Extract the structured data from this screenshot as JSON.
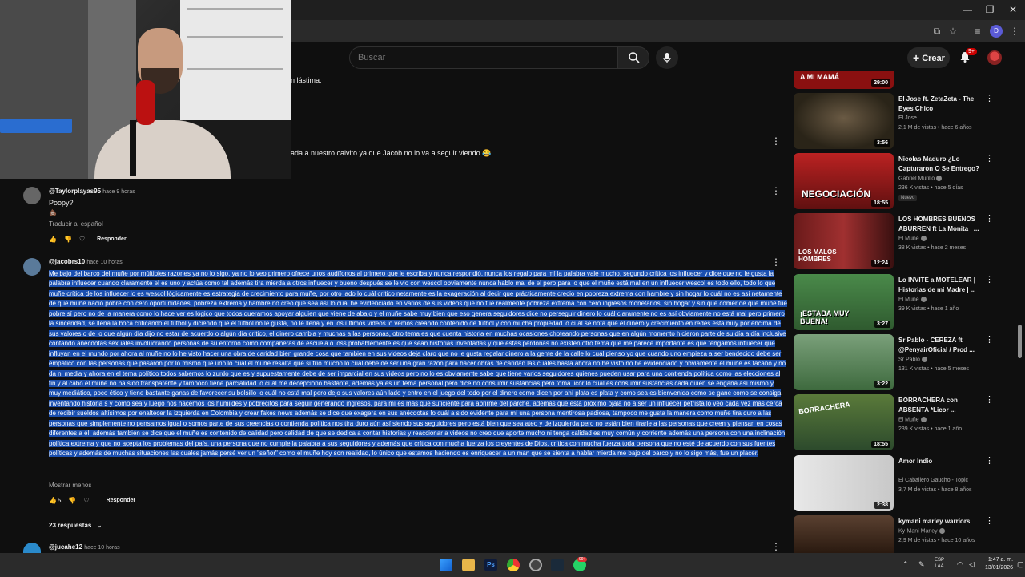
{
  "browser": {
    "window_controls": {
      "minimize": "—",
      "maximize": "❐",
      "close": "✕"
    },
    "profile_initial": "D"
  },
  "header": {
    "search_placeholder": "Buscar",
    "create_label": "Crear",
    "notifications_badge": "9+"
  },
  "partial_texts": {
    "line1": "n lástima.",
    "line2": "ada a nuestro calvito ya que Jacob no lo va a seguir viendo 😂"
  },
  "comments": [
    {
      "handle": "@Taylorplayas95",
      "time": "hace 9 horas",
      "text": "Poopy?",
      "emoji": "💩",
      "translate": "Traducir al español",
      "reply": "Responder"
    },
    {
      "handle": "@jacobrs10",
      "time": "hace 10 horas",
      "text": "Me bajo del barco del muñe por múltiples razones ya no lo sigo, ya no lo veo primero ofrece unos audífonos al primero que le escriba y nunca respondió, nunca los regalo para mí la palabra vale mucho, segundo crítica los influecer y dice que no le gusta la palabra influecer cuando claramente el es uno y actúa como tal además tira mierda a otros influecer y bueno después se le vio con wescol obviamente nunca hablo mal de el pero para lo que el muñe está mal en un influecer wescol es todo ello, todo lo que muñe crítica de los influecer lo es wescol lógicamente es estrategia de crecimiento para muñe, por otro lado lo cuál crítico netamente es la exageración al decir que prácticamente crecio en pobreza extrema con hambre y sin hogar lo cuál no es así netamente de que muñe nació pobre con cero oportunidades, pobreza extrema y hambre no creo que sea así lo cuál he evidenciado en varios de sus videos que no fue realmente pobreza extrema con cero ingresos monetarios, sin hogar y sin que comer de que muñe fue pobre sí pero no de la manera como lo hace ver es lógico que todos queramos apoyar alguien que viene de abajo y el muñe sabe muy bien que eso genera seguidores dice no perseguir dinero lo cuál claramente no es así obviamente no está mal pero primero la sinceridad, se llena la boca criticando el fútbol y diciendo que el fútbol no le gusta, no le llena y en los últimos videos lo vemos creando contenido de fútbol y con mucha propiedad lo cuál se nota que el dinero y crecimiento en redes está muy por encima de sus valores o de lo que algún día dijo no estar de acuerdo o algún día crítico, el dinero cambia y muchas a las personas, otro tema es que cuenta historia en muchas ocasiones choteando personas que en algún momento hicieron parte de su día a día inclusive contando anécdotas sexuales involucrando personas de su entorno como compañeras de escuela o loss probablemente es que sean historias inventadas y que estás perdonas no existen otro tema que me parece importante es que tengamos influecer que influyan en el mundo por ahora al muñe no lo he visto hacer una obra de caridad bien grande cosa que tambien en sus videos deja claro que no le gusta regalar dinero a la gente de la calle lo cuál pienso yo que cuando uno empieza a ser bendecido debe ser empatico con las personas que pasaron por lo mismo que uno lo cuál el muñe resalta que sufrió mucho lo cuál debe de ser una gran razón para hacer obras de caridad las cuales hasta ahora no he visto no he evidenciado y obviamente el muñe es tacaño y no da ni media y ahora en el tema político todos sabemos lo zurdo que es y supuestamente debe de ser imparcial en sus videos pero no lo es obviamente sabe que tiene varios seguidores quienes pueden usar para una contienda política como las elecciones al fin y al cabo el muñe no ha sido transparente y tampoco tiene parcialidad lo cuál me decepcióno bastante, además ya es un tema personal pero dice no consumir sustancias pero toma licor lo cuál es consumir sustancias cada quien se engaña así mismo y muy mediático, poco ético y tiene bastante ganas de favorecer su bolsillo lo cuál no está mal pero dejo sus valores aún lado y entro en el juego del todo por el dinero como dicen por ahí plata es plata y como sea es bienvenida como se gane como se consiga inventando historia s y como sea y luego nos hacemos los humildes y pobrecitos para seguir generando ingresos, para mí es más que suficiente para abrirme del parche, además que está próximo ojalá no a ser un influecer petrista lo veo cada vez más cerca de recibir sueldos altísimos por enaltecer la izquierda en Colombia y crear fakes news además se dice que exagera en sus anécdotas lo cuál a sido evidente para mí una persona mentirosa padiosa, tampoco me gusta la manera como muñe tira duro a las personas que simplemente no pensamos igual o somos parte de sus creencias o contienda política nos tira duro aún así siendo sus seguidores pero está bien que sea ateo y de izquierda pero no están bien tirarle a las personas que creen y piensan en cosas diferentes a él, además también se dice que el muñe es contenido de calidad pero calidad de que se dedica a contar historias y reaccionar a videos no creo que aporte mucho ni tenga calidad es muy común y corriente además una persona con una inclinación política extrema y que no acepta los problemas del país, una persona que no cumple la palabra a sus seguidores y además que crítica con mucha fuerza los creyentes de Dios, crítica con mucha fuerza toda persona que no esté de acuerdo con sus fuentes políticas y además de muchas situaciones las cuales jamás persé ver un \"señor\" como el muñe hoy son realidad, lo único que estamos haciendo es enriquecer a un man que se sienta a hablar mierda me bajo del barco y no lo sigo más, fue un placer.",
      "show_less": "Mostrar menos",
      "likes": "5",
      "reply": "Responder",
      "replies_count": "23 respuestas"
    },
    {
      "handle": "@jucahe12",
      "time": "hace 10 horas"
    }
  ],
  "sidebar": [
    {
      "title": "",
      "channel": "",
      "meta": "",
      "duration": "29:00",
      "thumb_text": "A MI MAMÁ",
      "thumb_color": "#8a1010"
    },
    {
      "title": "El Jose ft. ZetaZeta - The Eyes Chico",
      "channel": "El Jose",
      "meta": "2,1 M de vistas • hace 6 años",
      "duration": "3:56",
      "thumb_text": "",
      "thumb_color": "#3a3326"
    },
    {
      "title": "Nicolas Maduro ¿Lo Capturaron O Se Entrego?",
      "channel": "Gabriel Murillo",
      "meta": "236 K vistas • hace 5 días",
      "badge": "Nuevo",
      "duration": "18:55",
      "thumb_text": "NEGOCIACIÓN",
      "thumb_color": "#7a1a1a"
    },
    {
      "title": "LOS HOMBRES BUENOS ABURREN ft La Monita | ...",
      "channel": "El Muñe",
      "meta": "38 K vistas • hace 2 meses",
      "duration": "12:24",
      "thumb_text": "LOS MALOS HOMBRES",
      "thumb_color": "#5a1a1a"
    },
    {
      "title": "Lo INVITE a MOTELEAR | Historias de mi Madre | ...",
      "channel": "El Muñe",
      "meta": "39 K vistas • hace 1 año",
      "duration": "3:27",
      "thumb_text": "¡ESTABA MUY BUENA!",
      "thumb_color": "#2f5a2f"
    },
    {
      "title": "Sr Pablo - CEREZA ft @PenyairOficial  / Prod ...",
      "channel": "Sr Pablo",
      "meta": "131 K vistas • hace 5 meses",
      "duration": "3:22",
      "thumb_text": "",
      "thumb_color": "#3e6a3e"
    },
    {
      "title": "BORRACHERA con ABSENTA *Licor ...",
      "channel": "El Muñe",
      "meta": "239 K vistas • hace 1 año",
      "duration": "18:55",
      "thumb_text": "BORRACHERA",
      "thumb_color": "#2c4a2c"
    },
    {
      "title": "Amor Indio",
      "channel": "El Caballero Gaucho - Topic",
      "meta": "3,7 M de vistas • hace 8 años",
      "duration": "2:38",
      "thumb_text": "",
      "thumb_color": "#d8d8d8"
    },
    {
      "title": "kymani marley   warriors",
      "channel": "Ky-Mani Marley",
      "meta": "2,9 M de vistas • hace 10 años",
      "duration": "",
      "thumb_text": "",
      "thumb_color": "#3a2a1a"
    }
  ],
  "taskbar": {
    "lang_top": "ESP",
    "lang_bottom": "LAA",
    "time": "1:47 a. m.",
    "date": "13/01/2026",
    "badge": "99+"
  }
}
